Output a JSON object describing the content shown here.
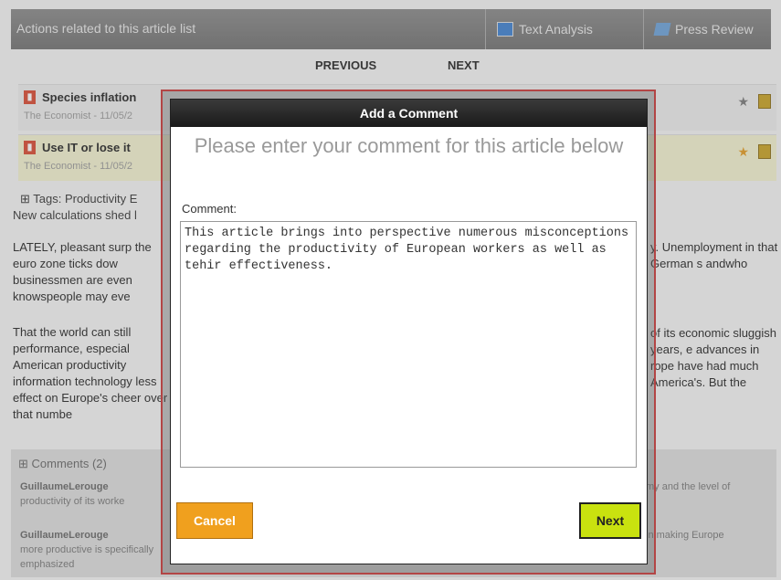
{
  "topbar": {
    "title": "Actions related to this article list",
    "text_analysis": "Text Analysis",
    "press_review": "Press Review"
  },
  "pager": {
    "previous": "PREVIOUS",
    "next": "NEXT"
  },
  "articles": [
    {
      "title": "Species inflation",
      "source": "The Economist - 11/05/2",
      "starred": false
    },
    {
      "title": "Use IT or lose it",
      "source": "The Economist - 11/05/2",
      "starred": true
    }
  ],
  "tags": "⊞ Tags: Productivity E",
  "subhead": "New calculations shed l",
  "paragraphs": {
    "left1": "LATELY, pleasant surp the euro zone ticks dow businessmen are even knowspeople may eve",
    "left2": "That the world can still performance, especial American productivity information technology less effect on Europe's cheer over that numbe",
    "right1": "y. Unemployment in that German s andwho",
    "right2": "of its economic sluggish years, e advances in rope have had much America's. But the"
  },
  "comments": {
    "header": "⊞ Comments (2)",
    "items": [
      {
        "author": "GuillaumeLerouge",
        "left_text": "productivity of its worke",
        "right_text": "my and the level of"
      },
      {
        "author": "GuillaumeLerouge",
        "left_text": "more productive is specifically emphasized",
        "right_text": "in making Europe"
      }
    ]
  },
  "modal": {
    "title": "Add a Comment",
    "prompt": "Please enter your comment for this article below",
    "comment_label": "Comment:",
    "comment_value": "This article brings into perspective numerous misconceptions regarding the productivity of European workers as well as tehir effectiveness.",
    "cancel_label": "Cancel",
    "next_label": "Next"
  },
  "colors": {
    "cancel": "#f0a01e",
    "next": "#c9e20f",
    "frame": "#b34545"
  }
}
